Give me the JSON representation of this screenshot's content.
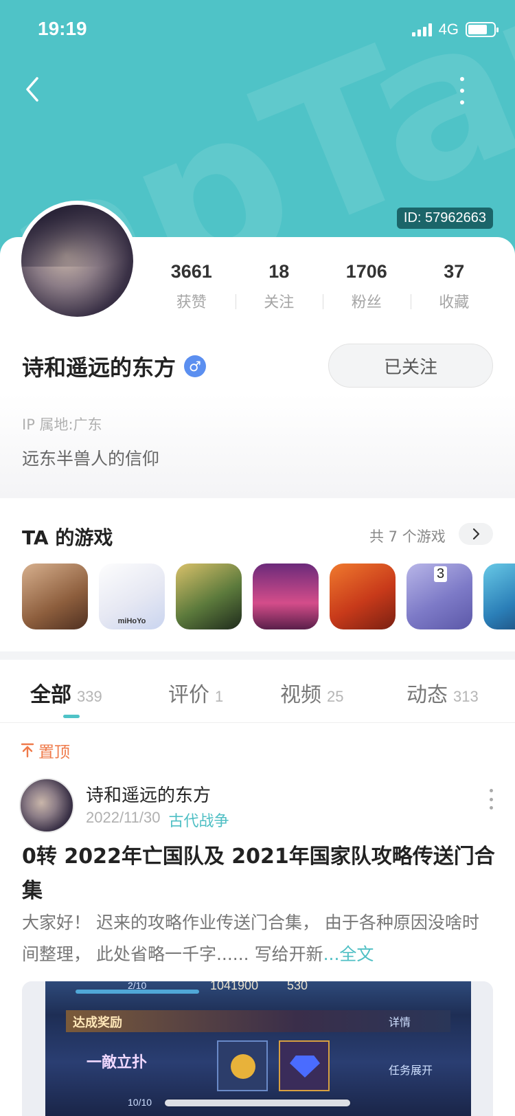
{
  "status_bar": {
    "time": "19:19",
    "network": "4G",
    "battery_level": 0.75
  },
  "header": {
    "watermark": "apTap",
    "user_id": "ID: 57962663",
    "back_icon": "chevron-left-icon",
    "more_icon": "vertical-dots-icon",
    "background_color": "#4fc3c7"
  },
  "profile": {
    "stats": [
      {
        "value": "3661",
        "label": "获赞"
      },
      {
        "value": "18",
        "label": "关注"
      },
      {
        "value": "1706",
        "label": "粉丝"
      },
      {
        "value": "37",
        "label": "收藏"
      }
    ],
    "name": "诗和遥远的东方",
    "gender_symbol": "♂",
    "follow_label": "已关注",
    "ip_location": "IP 属地:广东",
    "bio": "远东半兽人的信仰"
  },
  "games": {
    "title": "TA 的游戏",
    "count_label": "共 7 个游戏",
    "arrow_icon": "chevron-right-icon",
    "icons": [
      {
        "name": "game-icon-1",
        "label": ""
      },
      {
        "name": "game-icon-2",
        "label": "miHoYo"
      },
      {
        "name": "game-icon-3",
        "label": ""
      },
      {
        "name": "game-icon-4",
        "label": ""
      },
      {
        "name": "game-icon-5",
        "label": ""
      },
      {
        "name": "game-icon-6",
        "label": "3"
      },
      {
        "name": "game-icon-7",
        "label": ""
      }
    ]
  },
  "tabs": [
    {
      "label": "全部",
      "count": "339",
      "active": true
    },
    {
      "label": "评价",
      "count": "1",
      "active": false
    },
    {
      "label": "视频",
      "count": "25",
      "active": false
    },
    {
      "label": "动态",
      "count": "313",
      "active": false
    }
  ],
  "post": {
    "pinned_label": "置顶",
    "author": "诗和遥远的东方",
    "date": "2022/11/30",
    "tag": "古代战争",
    "title": "0转 2022年亡国队及 2021年国家队攻略传送门合集",
    "excerpt": "大家好！ 迟来的攻略作业传送门合集， 由于各种原因没啥时间整理， 此处省略一千字...... 写给开新",
    "read_more": "...全文",
    "image": {
      "progress_top": "2/10",
      "score_top": "1041900",
      "score_small": "530",
      "reward_title": "达成奖励",
      "detail": "详情",
      "emblem": "一敵立扑",
      "expand": "任务展开",
      "progress_bottom": "10/10"
    }
  }
}
